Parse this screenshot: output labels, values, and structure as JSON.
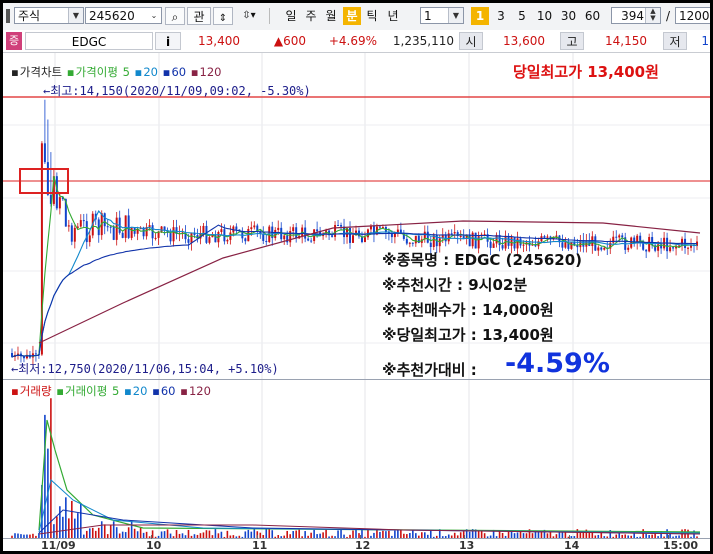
{
  "toolbar": {
    "market_type": "주식",
    "stock_code": "245620",
    "btn_search": "⌕",
    "btn_related": "관",
    "periods": [
      "일",
      "주",
      "월",
      "분",
      "틱",
      "년"
    ],
    "active_period": "분",
    "interval_value": "1",
    "interval_buttons": [
      "1",
      "3",
      "5",
      "10",
      "30",
      "60"
    ],
    "active_interval": "1",
    "count_value": "394",
    "count_separator": "/",
    "total_value": "1200"
  },
  "inforow": {
    "market_tag": "증",
    "stock_name": "EDGC",
    "info_button": "i",
    "price": "13,400",
    "change": "▲600",
    "change_pct": "+4.69%",
    "volume": "1,235,110",
    "open_label": "시",
    "open_value": "13,600",
    "high_label": "고",
    "high_value": "14,150",
    "low_label": "저",
    "low_value": "1"
  },
  "price_panel": {
    "legend": {
      "title": "가격차트",
      "ma_label": "가격이평",
      "ma_periods": [
        "5",
        "20",
        "60",
        "120"
      ]
    },
    "header_note": "당일최고가 13,400원",
    "high_annotation": "←최고:14,150(2020/11/09,09:02, -5.30%)",
    "low_annotation": "←최저:12,750(2020/11/06,15:04, +5.10%)",
    "info_box": {
      "line1": "※종목명 : EDGC (245620)",
      "line2": "※추천시간 : 9시02분",
      "line3": "※추천매수가 : 14,000원",
      "line4": "※당일최고가 : 13,400원",
      "line5_label": "※추천가대비 :",
      "line5_value": "-4.59%"
    }
  },
  "volume_panel": {
    "legend": {
      "title": "거래량",
      "ma_label": "거래이평",
      "ma_periods": [
        "5",
        "20",
        "60",
        "120"
      ]
    }
  },
  "x_axis": {
    "labels": [
      "11/09",
      "10",
      "11",
      "12",
      "13",
      "14",
      "15:00"
    ]
  },
  "colors": {
    "up": "#cc1111",
    "down": "#1144cc",
    "ma5": "#33aa33",
    "ma20": "#1188cc",
    "ma60": "#1133aa",
    "ma120": "#882244",
    "accent": "#f4b400",
    "highlight_line": "#dd2222",
    "pct_value": "#1133dd"
  }
}
